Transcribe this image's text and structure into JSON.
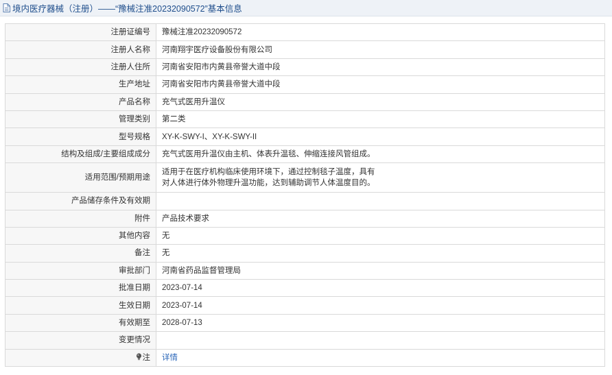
{
  "header": {
    "title": "境内医疗器械（注册）——“豫械注准20232090572”基本信息"
  },
  "rows": [
    {
      "label": "注册证编号",
      "value": "豫械注准20232090572"
    },
    {
      "label": "注册人名称",
      "value": "河南翔宇医疗设备股份有限公司"
    },
    {
      "label": "注册人住所",
      "value": "河南省安阳市内黄县帝誉大道中段"
    },
    {
      "label": "生产地址",
      "value": "河南省安阳市内黄县帝誉大道中段"
    },
    {
      "label": "产品名称",
      "value": "充气式医用升温仪"
    },
    {
      "label": "管理类别",
      "value": "第二类"
    },
    {
      "label": "型号规格",
      "value": "XY-K-SWY-I、XY-K-SWY-II"
    },
    {
      "label": "结构及组成/主要组成成分",
      "value": "充气式医用升温仪由主机、体表升温毯、伸缩连接风管组成。"
    },
    {
      "label": "适用范围/预期用途",
      "value_line1": "适用于在医疗机构临床使用环境下，通过控制毯子温度，具有",
      "value_line2": "对人体进行体外物理升温功能，达到辅助调节人体温度目的。"
    },
    {
      "label": "产品储存条件及有效期",
      "value": ""
    },
    {
      "label": "附件",
      "value": "产品技术要求"
    },
    {
      "label": "其他内容",
      "value": "无"
    },
    {
      "label": "备注",
      "value": "无"
    },
    {
      "label": "审批部门",
      "value": "河南省药品监督管理局"
    },
    {
      "label": "批准日期",
      "value": "2023-07-14"
    },
    {
      "label": "生效日期",
      "value": "2023-07-14"
    },
    {
      "label": "有效期至",
      "value": "2028-07-13"
    },
    {
      "label": "变更情况",
      "value": ""
    },
    {
      "label": "注",
      "value": "详情"
    }
  ],
  "icons": {
    "header_icon": "document-icon",
    "note_icon": "lightbulb-icon"
  },
  "colors": {
    "header_bg": "#eef2f7",
    "header_text": "#1f4e8c",
    "label_bg": "#f7f7f7",
    "border": "#d9d9d9",
    "link": "#2a66b8"
  }
}
